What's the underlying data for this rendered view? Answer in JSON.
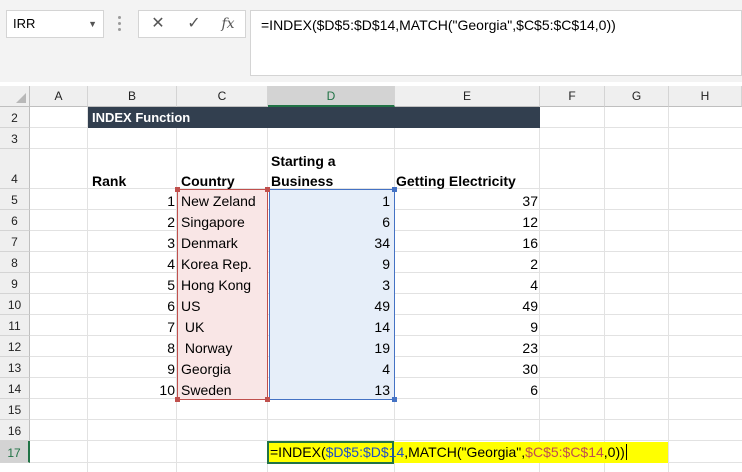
{
  "formula_bar": {
    "name_box": "IRR",
    "cancel_icon": "✕",
    "enter_icon": "✓",
    "function_icon": "fx",
    "formula": "=INDEX($D$5:$D$14,MATCH(\"Georgia\",$C$5:$C$14,0))"
  },
  "columns": [
    "A",
    "B",
    "C",
    "D",
    "E",
    "F",
    "G",
    "H"
  ],
  "rows": [
    "2",
    "3",
    "4",
    "5",
    "6",
    "7",
    "8",
    "9",
    "10",
    "11",
    "12",
    "13",
    "14",
    "15",
    "16",
    "17"
  ],
  "selected_column": "D",
  "selected_row": "17",
  "sheet": {
    "title": "INDEX Function",
    "headers": {
      "rank": "Rank",
      "country": "Country",
      "starting_line1": "Starting a",
      "starting_line2": "Business",
      "electricity": "Getting Electricity"
    },
    "table": [
      {
        "rank": "1",
        "country": "New Zeland",
        "starting": "1",
        "electricity": "37"
      },
      {
        "rank": "2",
        "country": "Singapore",
        "starting": "6",
        "electricity": "12"
      },
      {
        "rank": "3",
        "country": "Denmark",
        "starting": "34",
        "electricity": "16"
      },
      {
        "rank": "4",
        "country": "Korea Rep.",
        "starting": "9",
        "electricity": "2"
      },
      {
        "rank": "5",
        "country": "Hong Kong",
        "starting": "3",
        "electricity": "4"
      },
      {
        "rank": "6",
        "country": "US",
        "starting": "49",
        "electricity": "49"
      },
      {
        "rank": "7",
        "country": " UK",
        "starting": "14",
        "electricity": "9"
      },
      {
        "rank": "8",
        "country": " Norway",
        "starting": "19",
        "electricity": "23"
      },
      {
        "rank": "9",
        "country": "Georgia",
        "starting": "4",
        "electricity": "30"
      },
      {
        "rank": "10",
        "country": "Sweden",
        "starting": "13",
        "electricity": "6"
      }
    ],
    "edit_cell": {
      "part1": "=INDEX(",
      "part2": "$D$5:$D$14",
      "part3": ",MATCH(\"Georgia\",",
      "part4": "$C$5:$C$14",
      "part5": ",0))"
    }
  },
  "colors": {
    "title_bg": "#323f4f",
    "country_range": "#c0504d",
    "starting_range": "#4472c4",
    "highlight": "#ffff00",
    "selection": "#217346"
  }
}
